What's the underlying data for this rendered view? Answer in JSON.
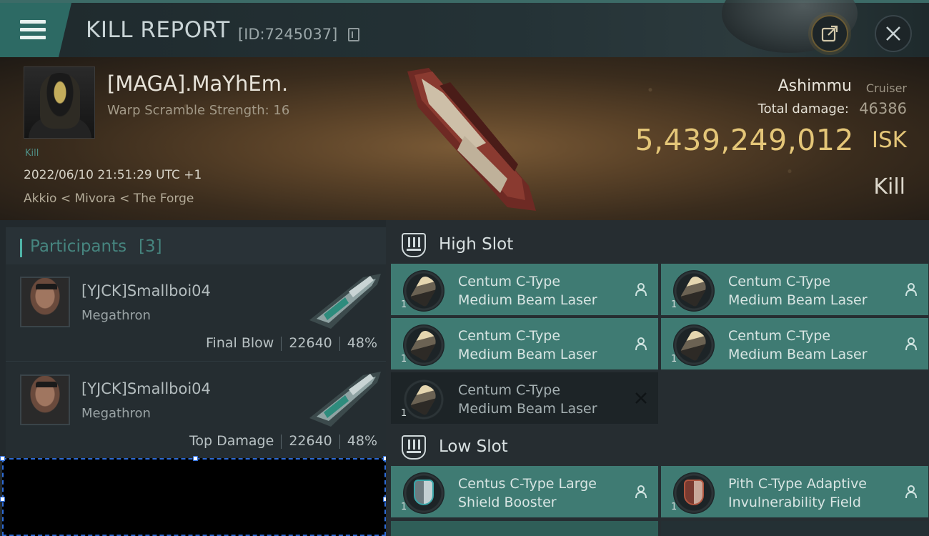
{
  "header": {
    "title": "KILL REPORT",
    "report_id": "[ID:7245037]"
  },
  "victim": {
    "name": "[MAGA].MaYhEm.",
    "warp_scramble": "Warp Scramble Strength: 16",
    "kill_tag": "Kill",
    "date": "2022/06/10 21:51:29 UTC +1",
    "location": "Akkio < Mivora < The Forge",
    "ship_name": "Ashimmu",
    "ship_class": "Cruiser",
    "total_damage_label": "Total damage:",
    "total_damage": "46386",
    "isk_value": "5,439,249,012",
    "isk_unit": "ISK",
    "status": "Kill"
  },
  "participants": {
    "label": "Participants",
    "count": "[3]",
    "items": [
      {
        "name": "[YJCK]Smallboi04",
        "ship": "Megathron",
        "role": "Final Blow",
        "damage": "22640",
        "percent": "48%"
      },
      {
        "name": "[YJCK]Smallboi04",
        "ship": "Megathron",
        "role": "Top Damage",
        "damage": "22640",
        "percent": "48%"
      }
    ]
  },
  "high_slot": {
    "label": "High Slot",
    "modules": [
      {
        "qty": "1",
        "line1": "Centum C-Type",
        "line2": "Medium Beam Laser",
        "status": "dropped"
      },
      {
        "qty": "1",
        "line1": "Centum C-Type",
        "line2": "Medium Beam Laser",
        "status": "dropped"
      },
      {
        "qty": "1",
        "line1": "Centum C-Type",
        "line2": "Medium Beam Laser",
        "status": "dropped"
      },
      {
        "qty": "1",
        "line1": "Centum C-Type",
        "line2": "Medium Beam Laser",
        "status": "dropped"
      },
      {
        "qty": "1",
        "line1": "Centum C-Type",
        "line2": "Medium Beam Laser",
        "status": "destroyed"
      }
    ]
  },
  "low_slot": {
    "label": "Low Slot",
    "modules": [
      {
        "qty": "1",
        "line1": "Centus C-Type Large",
        "line2": "Shield Booster",
        "status": "dropped"
      },
      {
        "qty": "1",
        "line1": "Pith C-Type Adaptive",
        "line2": "Invulnerability Field",
        "status": "dropped"
      }
    ]
  },
  "colors": {
    "accent_teal": "#3f7b73",
    "isk_gold": "#e4c678",
    "participants_text": "#46857f"
  },
  "icons": {
    "menu": "menu-icon",
    "copy": "copy-icon",
    "share": "share-icon",
    "close": "close-icon",
    "pilot": "pilot-icon",
    "destroyed": "x-icon"
  }
}
